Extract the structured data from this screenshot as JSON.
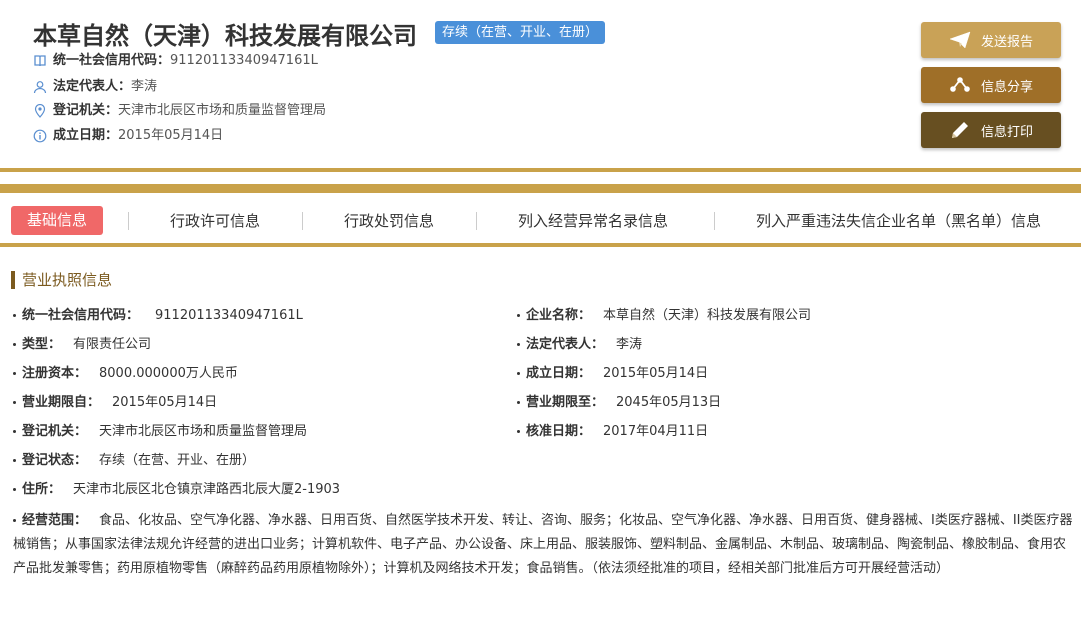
{
  "company": {
    "name": "本草自然（天津）科技发展有限公司",
    "status": "存续（在营、开业、在册）"
  },
  "summary": {
    "credit_code": {
      "label": "统一社会信用代码：",
      "value": "91120113340947161L"
    },
    "legal_rep": {
      "label": "法定代表人：",
      "value": "李涛"
    },
    "reg_authority": {
      "label": "登记机关：",
      "value": "天津市北辰区市场和质量监督管理局"
    },
    "established": {
      "label": "成立日期：",
      "value": "2015年05月14日"
    }
  },
  "actions": {
    "send": "发送报告",
    "share": "信息分享",
    "print": "信息打印"
  },
  "tabs": [
    {
      "label": "基础信息",
      "active": true
    },
    {
      "label": "行政许可信息"
    },
    {
      "label": "行政处罚信息"
    },
    {
      "label": "列入经营异常名录信息"
    },
    {
      "label": "列入严重违法失信企业名单（黑名单）信息"
    }
  ],
  "section": {
    "title": "营业执照信息",
    "left": [
      {
        "label": "统一社会信用代码：",
        "value": "91120113340947161L"
      },
      {
        "label": "类型：",
        "value": "有限责任公司"
      },
      {
        "label": "注册资本：",
        "value": "8000.000000万人民币"
      },
      {
        "label": "营业期限自：",
        "value": "2015年05月14日"
      },
      {
        "label": "登记机关：",
        "value": "天津市北辰区市场和质量监督管理局"
      },
      {
        "label": "登记状态：",
        "value": "存续（在营、开业、在册）"
      },
      {
        "label": "住所：",
        "value": "天津市北辰区北仓镇京津路西北辰大厦2-1903"
      }
    ],
    "right": [
      {
        "label": "企业名称：",
        "value": "本草自然（天津）科技发展有限公司"
      },
      {
        "label": "法定代表人：",
        "value": "李涛"
      },
      {
        "label": "成立日期：",
        "value": "2015年05月14日"
      },
      {
        "label": "营业期限至：",
        "value": "2045年05月13日"
      },
      {
        "label": "核准日期：",
        "value": "2017年04月11日"
      }
    ],
    "scope": {
      "label": "经营范围：",
      "value": "食品、化妆品、空气净化器、净水器、日用百货、自然医学技术开发、转让、咨询、服务；化妆品、空气净化器、净水器、日用百货、健身器械、I类医疗器械、II类医疗器械销售；从事国家法律法规允许经营的进出口业务；计算机软件、电子产品、办公设备、床上用品、服装服饰、塑料制品、金属制品、木制品、玻璃制品、陶瓷制品、橡胶制品、食用农产品批发兼零售；药用原植物零售（麻醉药品药用原植物除外）；计算机及网络技术开发；食品销售。（依法须经批准的项目，经相关部门批准后方可开展经营活动）"
    }
  },
  "colors": {
    "gold": "#c9a24a",
    "badge_blue": "#4a90d9",
    "active_tab": "#f06868",
    "btn_send": "#c9a257",
    "btn_share": "#9f6f28",
    "btn_print": "#674f21"
  },
  "icons": {
    "credit_code": "book-icon",
    "legal_rep": "user-icon",
    "reg_authority": "location-icon",
    "established": "info-icon",
    "send": "paper-plane-icon",
    "share": "share-icon",
    "print": "pencil-icon"
  }
}
